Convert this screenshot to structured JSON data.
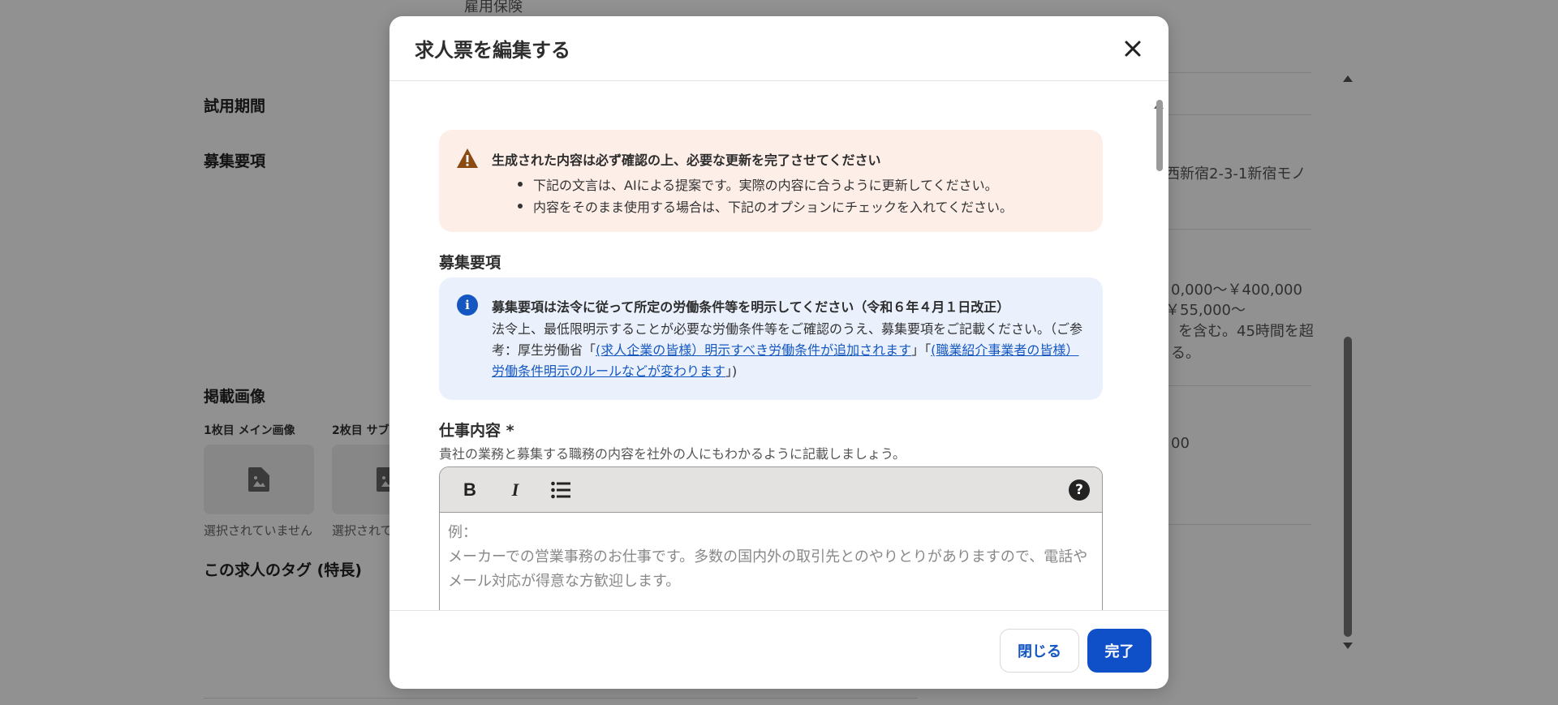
{
  "background": {
    "top_text": "雇用保険",
    "trial_period_label": "試用期間",
    "recruitment_label": "募集要項",
    "address_fragment": "西新宿2-3-1新宿モノ",
    "salary_fragment_1": "0,000～￥400,000",
    "salary_fragment_2": "￥55,000～",
    "salary_fragment_3": "を含む。45時間を超",
    "salary_fragment_4": "る。",
    "amount_fragment": "00",
    "images_label": "掲載画像",
    "image1_label": "1枚目 メイン画像",
    "image2_label": "2枚目 サブ",
    "not_selected_1": "選択されていません",
    "not_selected_2": "選択されて",
    "tags_label": "この求人のタグ (特長)"
  },
  "modal": {
    "title": "求人票を編集する",
    "warning": {
      "title": "生成された内容は必ず確認の上、必要な更新を完了させてください",
      "items": [
        "下記の文言は、AIによる提案です。実際の内容に合うように更新してください。",
        "内容をそのまま使用する場合は、下記のオプションにチェックを入れてください。"
      ]
    },
    "section_title": "募集要項",
    "info": {
      "icon_letter": "i",
      "title": "募集要項は法令に従って所定の労働条件等を明示してください（令和６年４月１日改正）",
      "text_before": "法令上、最低限明示することが必要な労働条件等をご確認のうえ、募集要項をご記載ください。（ご参考：厚生労働省「",
      "link1": "(求人企業の皆様）明示すべき労働条件が追加されます",
      "text_mid": "」「",
      "link2": "(職業紹介事業者の皆様）労働条件明示のルールなどが変わります",
      "text_after": "」)"
    },
    "field": {
      "label": "仕事内容 *",
      "help": "貴社の業務と募集する職務の内容を社外の人にもわかるように記載しましょう。",
      "toolbar": {
        "bold": "B",
        "italic": "I",
        "help": "?"
      },
      "placeholder": "例：\nメーカーでの営業事務のお仕事です。多数の国内外の取引先とのやりとりがありますので、電話やメール対応が得意な方歓迎します。"
    },
    "buttons": {
      "close": "閉じる",
      "done": "完了"
    }
  }
}
